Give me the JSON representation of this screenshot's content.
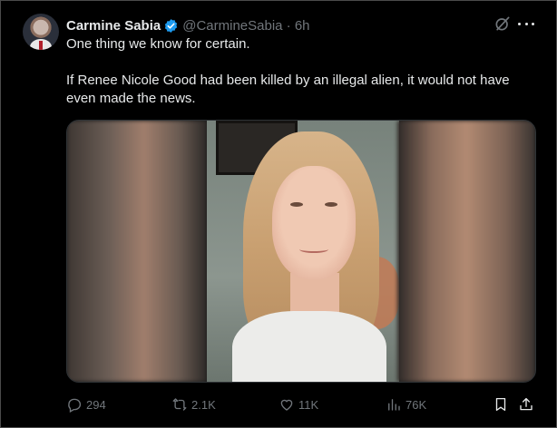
{
  "tweet": {
    "author_name": "Carmine Sabia",
    "handle_time": "@CarmineSabia · 6h",
    "text_lines": [
      "One thing we know for certain.",
      "If Renee Nicole Good had been killed by an illegal alien, it would not have even made the news."
    ],
    "verified_color": "#1d9bf0",
    "icons": [
      "grok-icon",
      "more-icon",
      "verified-badge-icon"
    ]
  },
  "metrics": {
    "replies": "294",
    "reposts": "2.1K",
    "likes": "11K",
    "views": "76K"
  },
  "colors": {
    "background": "#000000",
    "primary_text": "#e7e9ea",
    "secondary_text": "#71767b"
  }
}
